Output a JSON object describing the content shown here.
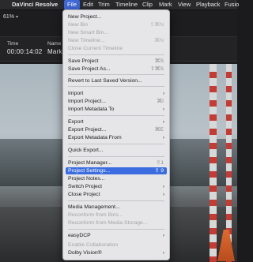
{
  "menubar": {
    "apple": "",
    "app_name": "DaVinci Resolve",
    "items": [
      "File",
      "Edit",
      "Trim",
      "Timeline",
      "Clip",
      "Mark",
      "View",
      "Playback",
      "Fusio"
    ]
  },
  "viewer": {
    "zoom": "61%",
    "timecode_header": "Time",
    "timecode_value": "00:00:14:02",
    "name_header": "Name",
    "name_value": "Mark"
  },
  "file_menu": {
    "items": [
      {
        "label": "New Project...",
        "shortcut": "",
        "disabled": false
      },
      {
        "label": "New Bin",
        "shortcut": "⇧⌘N",
        "disabled": true
      },
      {
        "label": "New Smart Bin...",
        "shortcut": "",
        "disabled": true
      },
      {
        "label": "New Timeline...",
        "shortcut": "⌘N",
        "disabled": true
      },
      {
        "label": "Close Current Timeline",
        "shortcut": "",
        "disabled": true
      },
      {
        "label": "Save Project",
        "shortcut": "⌘S",
        "disabled": false
      },
      {
        "label": "Save Project As...",
        "shortcut": "⇧⌘S",
        "disabled": false
      },
      {
        "label": "Revert to Last Saved Version...",
        "shortcut": "",
        "disabled": false
      },
      {
        "label": "Import",
        "shortcut": "",
        "disabled": false
      },
      {
        "label": "Import Project...",
        "shortcut": "⌘I",
        "disabled": false
      },
      {
        "label": "Import Metadata To",
        "shortcut": "",
        "disabled": false
      },
      {
        "label": "Export",
        "shortcut": "",
        "disabled": false
      },
      {
        "label": "Export Project...",
        "shortcut": "⌘E",
        "disabled": false
      },
      {
        "label": "Export Metadata From",
        "shortcut": "",
        "disabled": false
      },
      {
        "label": "Quick Export...",
        "shortcut": "",
        "disabled": false
      },
      {
        "label": "Project Manager...",
        "shortcut": "⇧1",
        "disabled": false
      },
      {
        "label": "Project Settings...",
        "shortcut": "⇧ 9",
        "disabled": false
      },
      {
        "label": "Project Notes...",
        "shortcut": "",
        "disabled": false
      },
      {
        "label": "Switch Project",
        "shortcut": "",
        "disabled": false
      },
      {
        "label": "Close Project",
        "shortcut": "",
        "disabled": false
      },
      {
        "label": "Media Management...",
        "shortcut": "",
        "disabled": false
      },
      {
        "label": "Reconform from Bins...",
        "shortcut": "",
        "disabled": true
      },
      {
        "label": "Reconform from Media Storage...",
        "shortcut": "",
        "disabled": true
      },
      {
        "label": "easyDCP",
        "shortcut": "",
        "disabled": false
      },
      {
        "label": "Enable Collaboration",
        "shortcut": "",
        "disabled": true
      },
      {
        "label": "Dolby Vision®",
        "shortcut": "",
        "disabled": false
      }
    ],
    "selected_index": 16
  },
  "accent_color": "#3b6de0"
}
